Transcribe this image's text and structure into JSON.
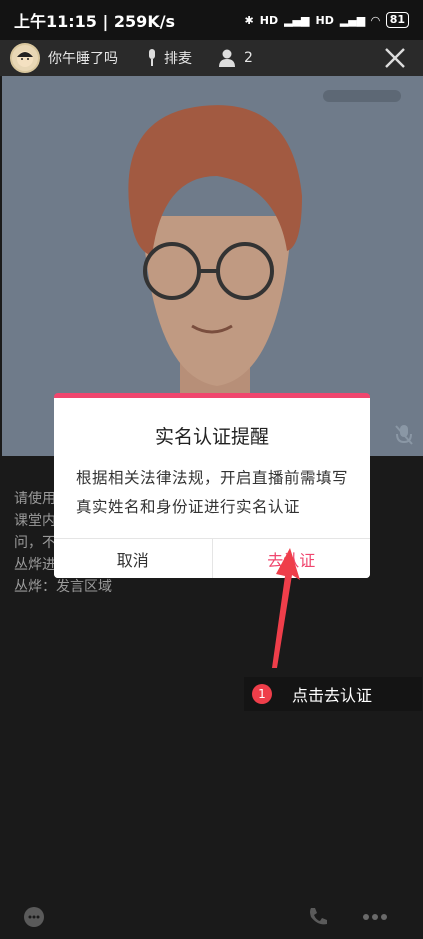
{
  "status_bar": {
    "time_speed": "上午11:15 | 259K/s",
    "battery": "81",
    "signal_labels": [
      "HD",
      "HD"
    ]
  },
  "top_bar": {
    "room_name": "你午睡了吗",
    "queue_label": "排麦",
    "viewer_count": "2"
  },
  "chat": {
    "lines": [
      "请使用",
      "课堂内",
      "问，不",
      "丛烨进",
      "丛烨：发言区域"
    ]
  },
  "dialog": {
    "title": "实名认证提醒",
    "body": "根据相关法律法规，开启直播前需填写真实姓名和身份证进行实名认证",
    "cancel_label": "取消",
    "confirm_label": "去认证"
  },
  "tip": {
    "step_number": "1",
    "text": "点击去认证"
  },
  "colors": {
    "accent": "#f0466e",
    "tip_badge": "#ef3e4a",
    "video_bg": "#6f7b8a"
  }
}
